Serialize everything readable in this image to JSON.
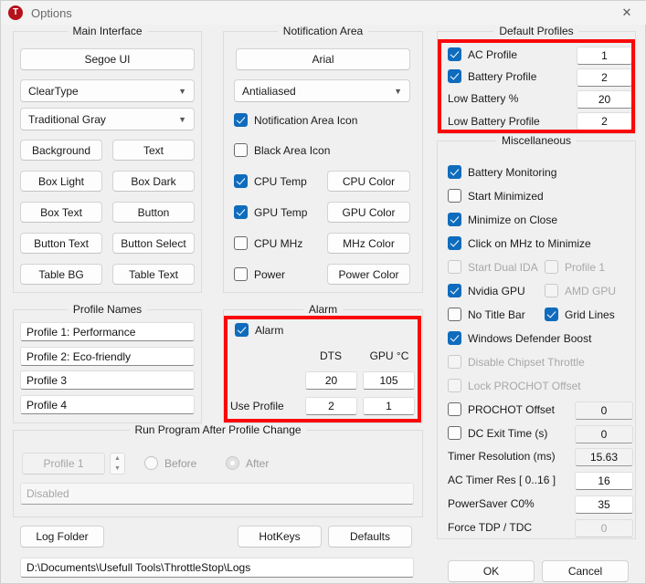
{
  "window": {
    "title": "Options",
    "app_icon": "throttlestop-icon",
    "app_icon_letter": "T",
    "close_label": "✕"
  },
  "main_interface": {
    "title": "Main Interface",
    "font_button": "Segoe UI",
    "rendering_combo": "ClearType",
    "theme_combo": "Traditional Gray",
    "color_buttons": [
      "Background",
      "Text",
      "Box Light",
      "Box Dark",
      "Box Text",
      "Button",
      "Button Text",
      "Button Select",
      "Table BG",
      "Table Text"
    ]
  },
  "notification_area": {
    "title": "Notification Area",
    "font_button": "Arial",
    "rendering_combo": "Antialiased",
    "checkboxes": [
      {
        "label": "Notification Area Icon",
        "checked": true
      },
      {
        "label": "Black Area Icon",
        "checked": false
      },
      {
        "label": "CPU Temp",
        "checked": true
      },
      {
        "label": "GPU Temp",
        "checked": true
      },
      {
        "label": "CPU MHz",
        "checked": false
      },
      {
        "label": "Power",
        "checked": false
      }
    ],
    "color_buttons": [
      "CPU Color",
      "GPU Color",
      "MHz Color",
      "Power Color"
    ]
  },
  "default_profiles": {
    "title": "Default Profiles",
    "rows": [
      {
        "label": "AC Profile",
        "has_checkbox": true,
        "checked": true,
        "value": "1"
      },
      {
        "label": "Battery Profile",
        "has_checkbox": true,
        "checked": true,
        "value": "2"
      },
      {
        "label": "Low Battery %",
        "has_checkbox": false,
        "checked": false,
        "value": "20"
      },
      {
        "label": "Low Battery Profile",
        "has_checkbox": false,
        "checked": false,
        "value": "2"
      }
    ],
    "highlight_color": "#fa0808"
  },
  "miscellaneous": {
    "title": "Miscellaneous",
    "checkboxes": [
      {
        "label": "Battery Monitoring",
        "checked": true,
        "disabled": false
      },
      {
        "label": "Start Minimized",
        "checked": false,
        "disabled": false
      },
      {
        "label": "Minimize on Close",
        "checked": true,
        "disabled": false
      },
      {
        "label": "Click on MHz to Minimize",
        "checked": true,
        "disabled": false
      },
      {
        "label": "Start Dual IDA",
        "checked": false,
        "disabled": true
      },
      {
        "label": "Profile 1",
        "checked": false,
        "disabled": true
      },
      {
        "label": "Nvidia GPU",
        "checked": true,
        "disabled": false
      },
      {
        "label": "AMD GPU",
        "checked": false,
        "disabled": true
      },
      {
        "label": "No Title Bar",
        "checked": false,
        "disabled": false
      },
      {
        "label": "Grid Lines",
        "checked": true,
        "disabled": false
      },
      {
        "label": "Windows Defender Boost",
        "checked": true,
        "disabled": false
      },
      {
        "label": "Disable Chipset Throttle",
        "checked": false,
        "disabled": true
      },
      {
        "label": "Lock PROCHOT Offset",
        "checked": false,
        "disabled": true
      }
    ],
    "value_rows": [
      {
        "label": "PROCHOT Offset",
        "has_checkbox": true,
        "checked": false,
        "value": "0",
        "style": "readonly"
      },
      {
        "label": "DC Exit Time (s)",
        "has_checkbox": true,
        "checked": false,
        "value": "0",
        "style": "readonly"
      },
      {
        "label": "Timer Resolution (ms)",
        "has_checkbox": false,
        "checked": false,
        "value": "15.63",
        "style": "readonly"
      },
      {
        "label": "AC Timer Res [ 0..16 ]",
        "has_checkbox": false,
        "checked": false,
        "value": "16",
        "style": "normal"
      },
      {
        "label": "PowerSaver C0%",
        "has_checkbox": false,
        "checked": false,
        "value": "35",
        "style": "normal"
      },
      {
        "label": "Force TDP / TDC",
        "has_checkbox": false,
        "checked": false,
        "value": "0",
        "style": "disabled"
      }
    ]
  },
  "profile_names": {
    "title": "Profile Names",
    "values": [
      "Profile 1: Performance",
      "Profile 2: Eco-friendly",
      "Profile 3",
      "Profile 4"
    ]
  },
  "alarm": {
    "title": "Alarm",
    "enable_label": "Alarm",
    "enabled": true,
    "col_dts": "DTS",
    "col_gpu": "GPU °C",
    "use_profile_label": "Use Profile",
    "threshold_dts": "20",
    "threshold_gpu": "105",
    "profile_dts": "2",
    "profile_gpu": "1",
    "highlight_color": "#fa0808"
  },
  "run_program": {
    "title": "Run Program After Profile Change",
    "profile_selector": "Profile 1",
    "radio_before": "Before",
    "radio_after": "After",
    "selected_radio": "After",
    "program_path": "Disabled"
  },
  "footer": {
    "log_folder_button": "Log Folder",
    "hotkeys_button": "HotKeys",
    "defaults_button": "Defaults",
    "log_path": "D:\\Documents\\Usefull Tools\\ThrottleStop\\Logs",
    "ok_button": "OK",
    "cancel_button": "Cancel"
  }
}
